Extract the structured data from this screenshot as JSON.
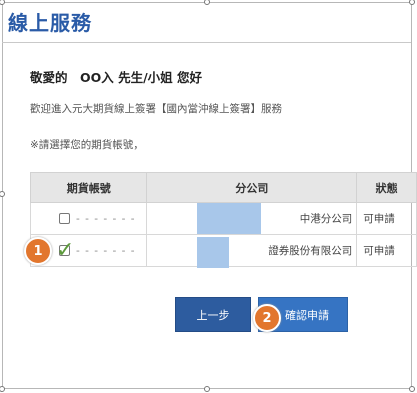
{
  "window": {
    "title": "線上服務"
  },
  "greeting": "敬愛的　OO入 先生/小姐 您好",
  "intro": "歡迎進入元大期貨線上簽署【國內當沖線上簽署】服務",
  "note": "※請選擇您的期貨帳號，",
  "table": {
    "headers": [
      "期貨帳號",
      "分公司",
      "狀態"
    ],
    "rows": [
      {
        "account": "- - - - - - -",
        "branch": "中港分公司",
        "status": "可申請"
      },
      {
        "account": "- - - - - - -",
        "branch": "證券股份有限公司",
        "status": "可申請"
      }
    ]
  },
  "buttons": {
    "prev": "上一步",
    "confirm": "確認申請"
  },
  "badges": {
    "step1": "1",
    "step2": "2"
  },
  "icons": {
    "check": "check-icon"
  },
  "colors": {
    "title": "#2a5ba7",
    "badge": "#e2762d",
    "button": "#2d5c9f",
    "mask": "#a8c7ea"
  }
}
